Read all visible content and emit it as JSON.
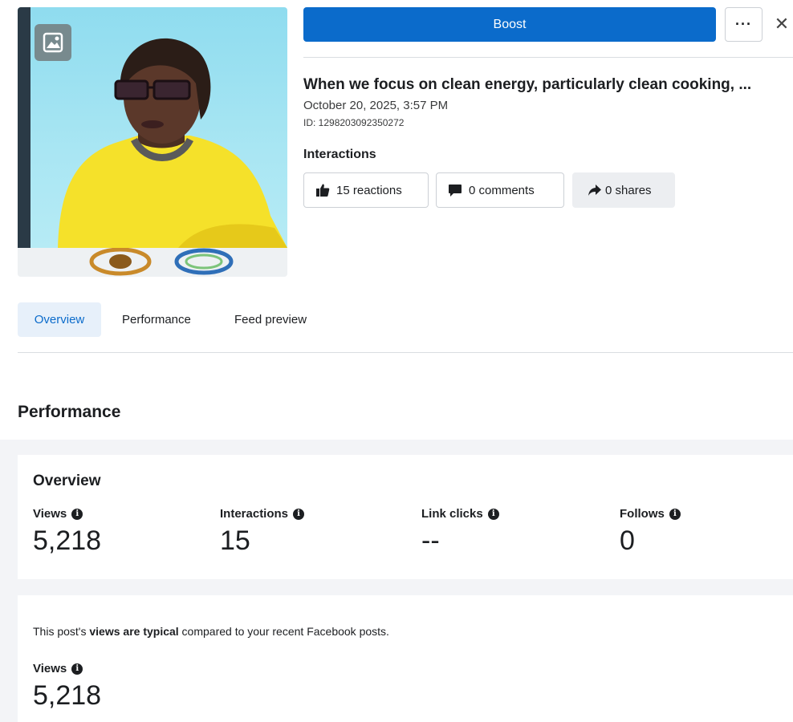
{
  "header": {
    "boost_label": "Boost",
    "more_label": "···",
    "close_label": "✕"
  },
  "post": {
    "title": "When we focus on clean energy, particularly clean cooking, ...",
    "date": "October 20, 2025, 3:57 PM",
    "id": "ID: 1298203092350272"
  },
  "interactions": {
    "label": "Interactions",
    "reactions": "15 reactions",
    "comments": "0 comments",
    "shares": "0 shares"
  },
  "tabs": [
    {
      "label": "Overview",
      "active": true
    },
    {
      "label": "Performance",
      "active": false
    },
    {
      "label": "Feed preview",
      "active": false
    }
  ],
  "performance": {
    "section_title": "Performance",
    "overview": {
      "title": "Overview",
      "metrics": [
        {
          "label": "Views",
          "value": "5,218"
        },
        {
          "label": "Interactions",
          "value": "15"
        },
        {
          "label": "Link clicks",
          "value": "--"
        },
        {
          "label": "Follows",
          "value": "0"
        }
      ]
    },
    "views_card": {
      "sentence_prefix": "This post's ",
      "sentence_bold": "views are typical",
      "sentence_suffix": " compared to your recent Facebook posts.",
      "label": "Views",
      "value": "5,218"
    }
  },
  "colors": {
    "accent": "#0b6bcb",
    "tab_active_bg": "#e7f0fa",
    "panel_bg": "#f3f4f7"
  },
  "icons": {
    "thumb_badge": "image-icon",
    "reactions": "thumbs-up-icon",
    "comments": "comment-icon",
    "shares": "share-arrow-icon",
    "info": "info-icon"
  }
}
